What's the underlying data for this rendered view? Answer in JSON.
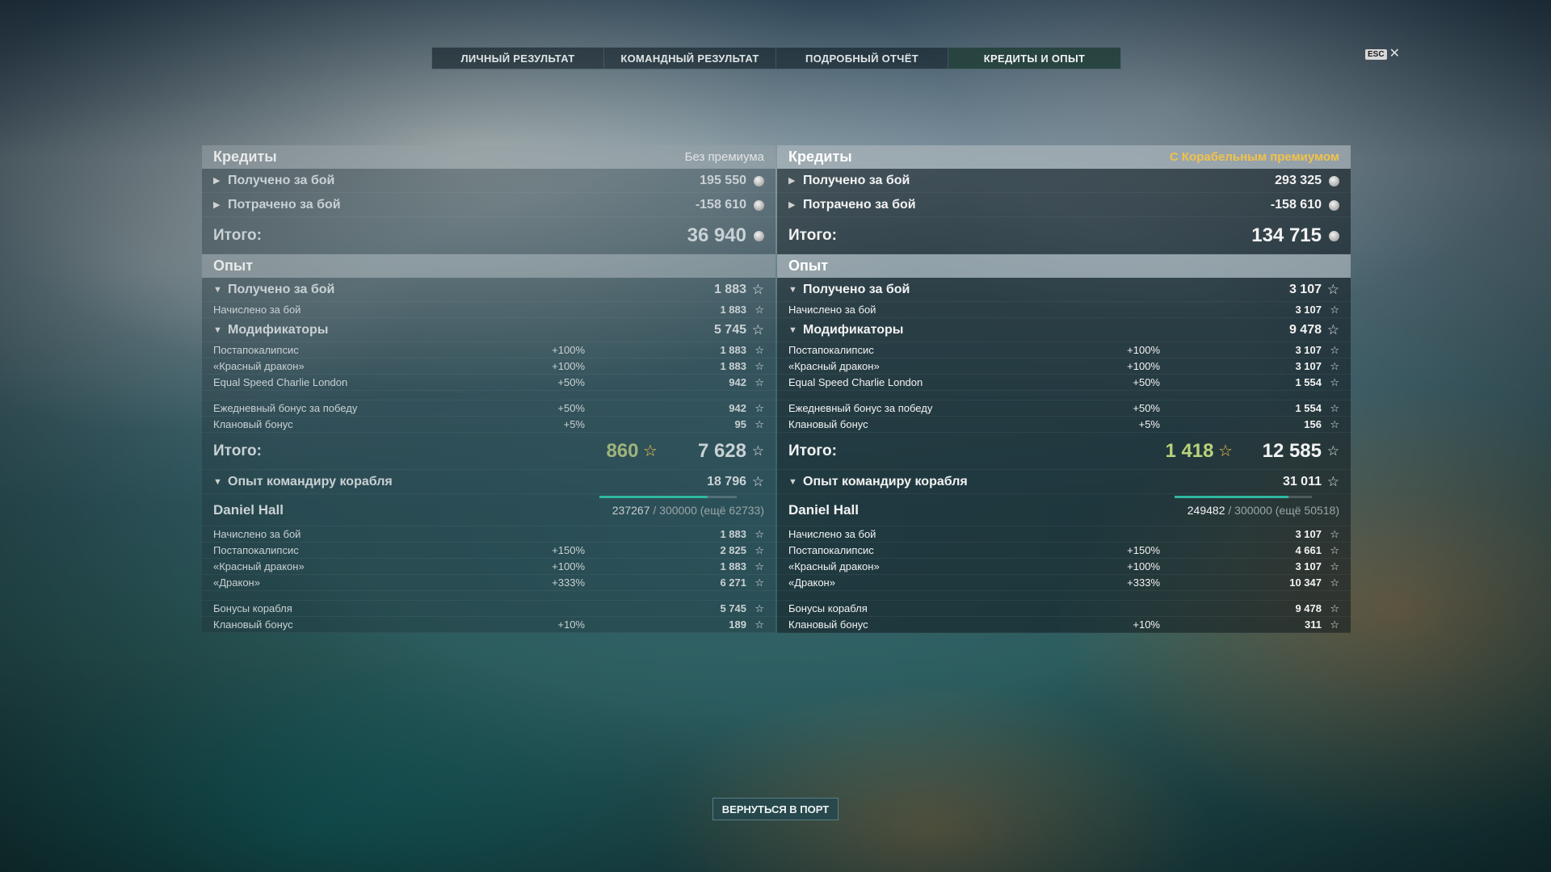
{
  "tabs": [
    {
      "label": "ЛИЧНЫЙ РЕЗУЛЬТАТ"
    },
    {
      "label": "КОМАНДНЫЙ РЕЗУЛЬТАТ"
    },
    {
      "label": "ПОДРОБНЫЙ ОТЧЁТ"
    },
    {
      "label": "КРЕДИТЫ И ОПЫТ"
    }
  ],
  "active_tab": "КРЕДИТЫ И ОПЫТ",
  "esc_label": "ESC",
  "close_glyph": "✕",
  "back_button": "ВЕРНУТЬСЯ В ПОРТ",
  "colors": {
    "accent_gold": "#f1c24a",
    "accent_green": "#b9d27a",
    "progress": "#2fb8a0"
  },
  "left": {
    "credits_title": "Кредиты",
    "mode": "Без премиума",
    "earned_label": "Получено за бой",
    "earned": "195 550",
    "spent_label": "Потрачено за бой",
    "spent": "-158 610",
    "credits_total_label": "Итого:",
    "credits_total": "36 940",
    "xp_title": "Опыт",
    "xp_earned_label": "Получено за бой",
    "xp_earned": "1 883",
    "xp_base_label": "Начислено за бой",
    "xp_base": "1 883",
    "modifiers_label": "Модификаторы",
    "modifiers_total": "5 745",
    "mods": [
      {
        "name": "Постапокалипсис",
        "pct": "+100%",
        "val": "1 883"
      },
      {
        "name": "«Красный дракон»",
        "pct": "+100%",
        "val": "1 883"
      },
      {
        "name": "Equal Speed Charlie London",
        "pct": "+50%",
        "val": "942"
      }
    ],
    "mods2": [
      {
        "name": "Ежедневный бонус за победу",
        "pct": "+50%",
        "val": "942"
      },
      {
        "name": "Клановый бонус",
        "pct": "+5%",
        "val": "95"
      }
    ],
    "xp_total_label": "Итого:",
    "xp_free": "860",
    "xp_total": "7 628",
    "cmd_label": "Опыт командиру корабля",
    "cmd_total": "18 796",
    "commander": "Daniel Hall",
    "cmd_progress_cur": "237267",
    "cmd_progress_rest": "/ 300000 (ещё 62733)",
    "cmd_progress_fraction": 0.79,
    "cmd_rows": [
      {
        "name": "Начислено за бой",
        "pct": "",
        "val": "1 883"
      },
      {
        "name": "Постапокалипсис",
        "pct": "+150%",
        "val": "2 825"
      },
      {
        "name": "«Красный дракон»",
        "pct": "+100%",
        "val": "1 883"
      },
      {
        "name": "«Дракон»",
        "pct": "+333%",
        "val": "6 271"
      }
    ],
    "cmd_rows2": [
      {
        "name": "Бонусы корабля",
        "pct": "",
        "val": "5 745"
      },
      {
        "name": "Клановый бонус",
        "pct": "+10%",
        "val": "189"
      }
    ]
  },
  "right": {
    "credits_title": "Кредиты",
    "mode": "С Корабельным премиумом",
    "earned_label": "Получено за бой",
    "earned": "293 325",
    "spent_label": "Потрачено за бой",
    "spent": "-158 610",
    "credits_total_label": "Итого:",
    "credits_total": "134 715",
    "xp_title": "Опыт",
    "xp_earned_label": "Получено за бой",
    "xp_earned": "3 107",
    "xp_base_label": "Начислено за бой",
    "xp_base": "3 107",
    "modifiers_label": "Модификаторы",
    "modifiers_total": "9 478",
    "mods": [
      {
        "name": "Постапокалипсис",
        "pct": "+100%",
        "val": "3 107"
      },
      {
        "name": "«Красный дракон»",
        "pct": "+100%",
        "val": "3 107"
      },
      {
        "name": "Equal Speed Charlie London",
        "pct": "+50%",
        "val": "1 554"
      }
    ],
    "mods2": [
      {
        "name": "Ежедневный бонус за победу",
        "pct": "+50%",
        "val": "1 554"
      },
      {
        "name": "Клановый бонус",
        "pct": "+5%",
        "val": "156"
      }
    ],
    "xp_total_label": "Итого:",
    "xp_free": "1 418",
    "xp_total": "12 585",
    "cmd_label": "Опыт командиру корабля",
    "cmd_total": "31 011",
    "commander": "Daniel Hall",
    "cmd_progress_cur": "249482",
    "cmd_progress_rest": "/ 300000 (ещё 50518)",
    "cmd_progress_fraction": 0.83,
    "cmd_rows": [
      {
        "name": "Начислено за бой",
        "pct": "",
        "val": "3 107"
      },
      {
        "name": "Постапокалипсис",
        "pct": "+150%",
        "val": "4 661"
      },
      {
        "name": "«Красный дракон»",
        "pct": "+100%",
        "val": "3 107"
      },
      {
        "name": "«Дракон»",
        "pct": "+333%",
        "val": "10 347"
      }
    ],
    "cmd_rows2": [
      {
        "name": "Бонусы корабля",
        "pct": "",
        "val": "9 478"
      },
      {
        "name": "Клановый бонус",
        "pct": "+10%",
        "val": "311"
      }
    ]
  }
}
